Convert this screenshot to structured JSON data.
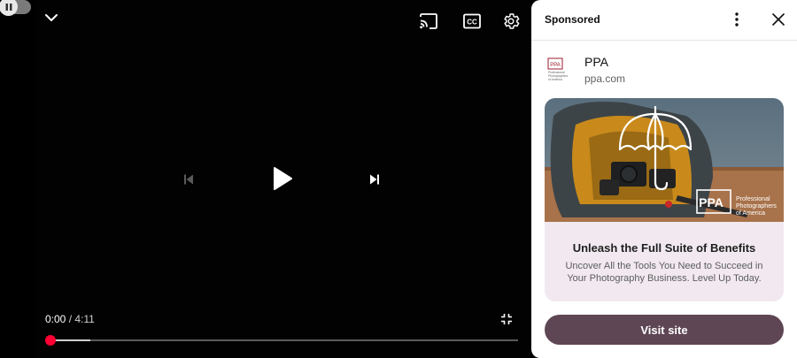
{
  "player": {
    "time": {
      "current": "0:00",
      "separator": "/",
      "duration": "4:11"
    },
    "progress": {
      "played_fraction": 0.0,
      "buffered_fraction": 0.085
    },
    "autoplay": {
      "state": "on",
      "icon": "pause-icon"
    },
    "icons": {
      "collapse": "chevron-down-icon",
      "cast": "cast-icon",
      "captions": "cc-icon",
      "settings": "gear-icon",
      "previous": "skip-previous-icon",
      "play": "play-icon",
      "next": "skip-next-icon",
      "fullscreen": "exit-fullscreen-icon"
    },
    "colors": {
      "scrubber": "#ff0033",
      "background": "#000000"
    }
  },
  "panel": {
    "title": "Sponsored",
    "icons": {
      "more": "more-vert-icon",
      "close": "close-icon"
    },
    "advertiser": {
      "name": "PPA",
      "domain": "ppa.com"
    },
    "logo_text": {
      "mark": "PPA",
      "full": "Professional Photographers of America"
    },
    "ad": {
      "image_mark": "PPA",
      "image_tagline": [
        "Professional",
        "Photographers",
        "of America"
      ],
      "headline": "Unleash the Full Suite of Benefits",
      "body": "Uncover All the Tools You Need to Succeed in Your Photography Business. Level Up Today."
    },
    "cta_label": "Visit site",
    "colors": {
      "card_bg": "#f1e9ef",
      "cta_bg": "#5e4654",
      "cta_text": "#ffffff"
    }
  }
}
